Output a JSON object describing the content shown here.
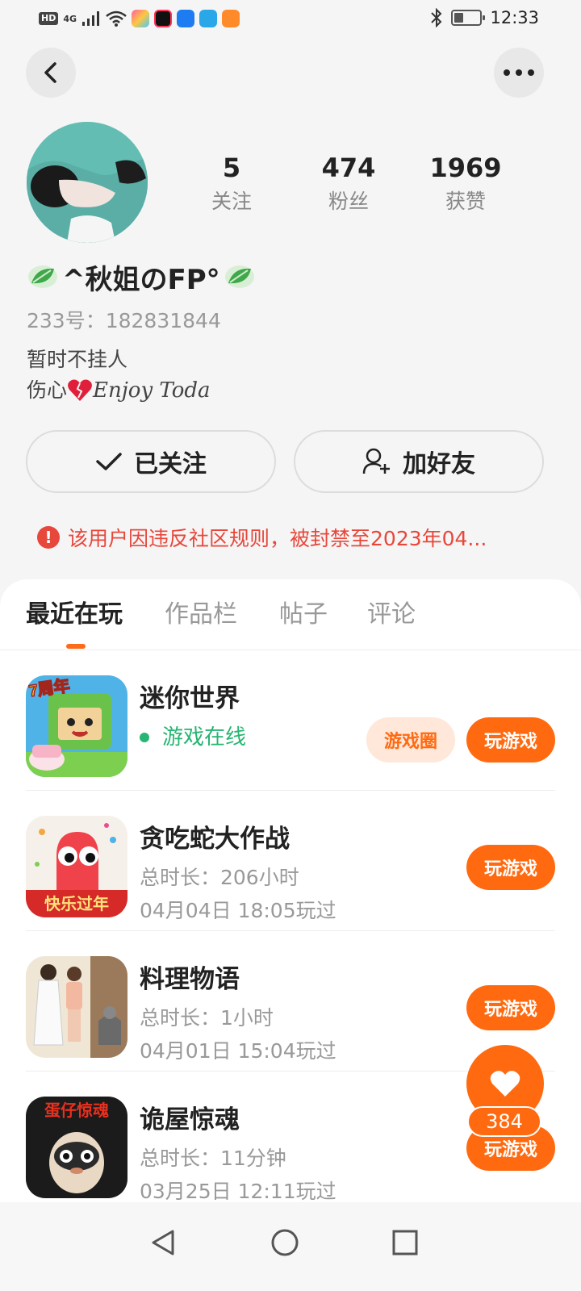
{
  "status_bar": {
    "hd": "HD",
    "network": "4G",
    "time": "12:33",
    "battery_level": 0.35,
    "app_icons": [
      "colorful-app-icon",
      "video-app-icon",
      "bulb-app-icon",
      "book-app-icon",
      "play-app-icon"
    ]
  },
  "profile": {
    "username": "^秋姐のFP°",
    "uid": "233号：182831844",
    "bio_line1": "暂时不挂人",
    "bio_line2_prefix": "伤心",
    "bio_line2_suffix": "Enjoy Toda",
    "stats": [
      {
        "value": "5",
        "label": "关注"
      },
      {
        "value": "474",
        "label": "粉丝"
      },
      {
        "value": "1969",
        "label": "获赞"
      }
    ]
  },
  "actions": {
    "follow_label": "已关注",
    "friend_label": "加好友"
  },
  "ban_notice": "该用户因违反社区规则，被封禁至2023年04...",
  "tabs": [
    "最近在玩",
    "作品栏",
    "帖子",
    "评论"
  ],
  "active_tab": "最近在玩",
  "games": [
    {
      "name": "迷你世界",
      "status": "游戏在线",
      "circle_label": "游戏圈",
      "play_label": "玩游戏"
    },
    {
      "name": "贪吃蛇大作战",
      "duration": "总时长：206小时",
      "last_played": "04月04日 18:05玩过",
      "play_label": "玩游戏",
      "badge": "快乐过年"
    },
    {
      "name": "料理物语",
      "duration": "总时长：1小时",
      "last_played": "04月01日 15:04玩过",
      "play_label": "玩游戏"
    },
    {
      "name": "诡屋惊魂",
      "duration": "总时长：11分钟",
      "last_played": "03月25日 12:11玩过",
      "play_label": "玩游戏",
      "badge": "蛋仔惊魂"
    }
  ],
  "minecraft_badge": "7周年",
  "like_count": "384",
  "colors": {
    "accent": "#ff6a10",
    "online": "#27b573",
    "warning": "#e8473b"
  }
}
